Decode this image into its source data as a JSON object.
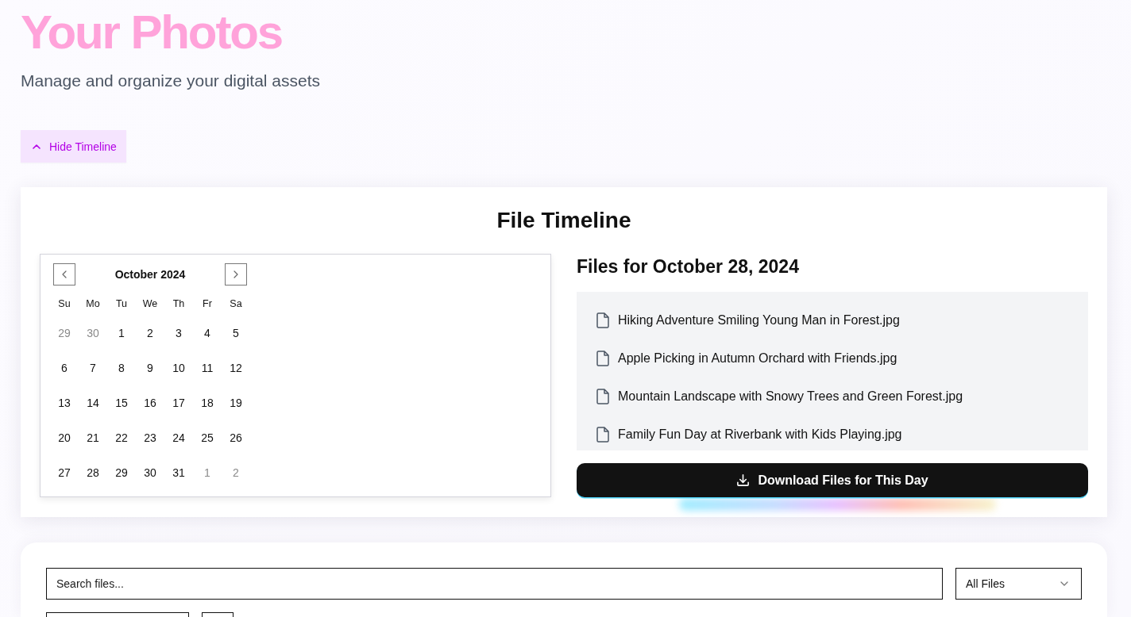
{
  "header": {
    "title": "Your Photos",
    "subtitle": "Manage and organize your digital assets"
  },
  "timeline_toggle": {
    "label": "Hide Timeline",
    "expanded": true
  },
  "timeline": {
    "title": "File Timeline",
    "calendar": {
      "month": "October 2024",
      "weekdays": [
        "Su",
        "Mo",
        "Tu",
        "We",
        "Th",
        "Fr",
        "Sa"
      ],
      "weeks": [
        [
          {
            "day": "29",
            "outside": true
          },
          {
            "day": "30",
            "outside": true
          },
          {
            "day": "1",
            "outside": false
          },
          {
            "day": "2",
            "outside": false
          },
          {
            "day": "3",
            "outside": false
          },
          {
            "day": "4",
            "outside": false
          },
          {
            "day": "5",
            "outside": false
          }
        ],
        [
          {
            "day": "6",
            "outside": false
          },
          {
            "day": "7",
            "outside": false
          },
          {
            "day": "8",
            "outside": false
          },
          {
            "day": "9",
            "outside": false
          },
          {
            "day": "10",
            "outside": false
          },
          {
            "day": "11",
            "outside": false
          },
          {
            "day": "12",
            "outside": false
          }
        ],
        [
          {
            "day": "13",
            "outside": false
          },
          {
            "day": "14",
            "outside": false
          },
          {
            "day": "15",
            "outside": false
          },
          {
            "day": "16",
            "outside": false
          },
          {
            "day": "17",
            "outside": false
          },
          {
            "day": "18",
            "outside": false
          },
          {
            "day": "19",
            "outside": false
          }
        ],
        [
          {
            "day": "20",
            "outside": false
          },
          {
            "day": "21",
            "outside": false
          },
          {
            "day": "22",
            "outside": false
          },
          {
            "day": "23",
            "outside": false
          },
          {
            "day": "24",
            "outside": false
          },
          {
            "day": "25",
            "outside": false
          },
          {
            "day": "26",
            "outside": false
          }
        ],
        [
          {
            "day": "27",
            "outside": false
          },
          {
            "day": "28",
            "outside": false
          },
          {
            "day": "29",
            "outside": false
          },
          {
            "day": "30",
            "outside": false
          },
          {
            "day": "31",
            "outside": false
          },
          {
            "day": "1",
            "outside": true
          },
          {
            "day": "2",
            "outside": true
          }
        ]
      ]
    },
    "files_heading": "Files for October 28, 2024",
    "files": [
      "Hiking Adventure Smiling Young Man in Forest.jpg",
      "Apple Picking in Autumn Orchard with Friends.jpg",
      "Mountain Landscape with Snowy Trees and Green Forest.jpg",
      "Family Fun Day at Riverbank with Kids Playing.jpg"
    ],
    "download_button": "Download Files for This Day"
  },
  "filters": {
    "search": {
      "placeholder": "Search files..."
    },
    "type_select": {
      "value": "All Files"
    }
  }
}
